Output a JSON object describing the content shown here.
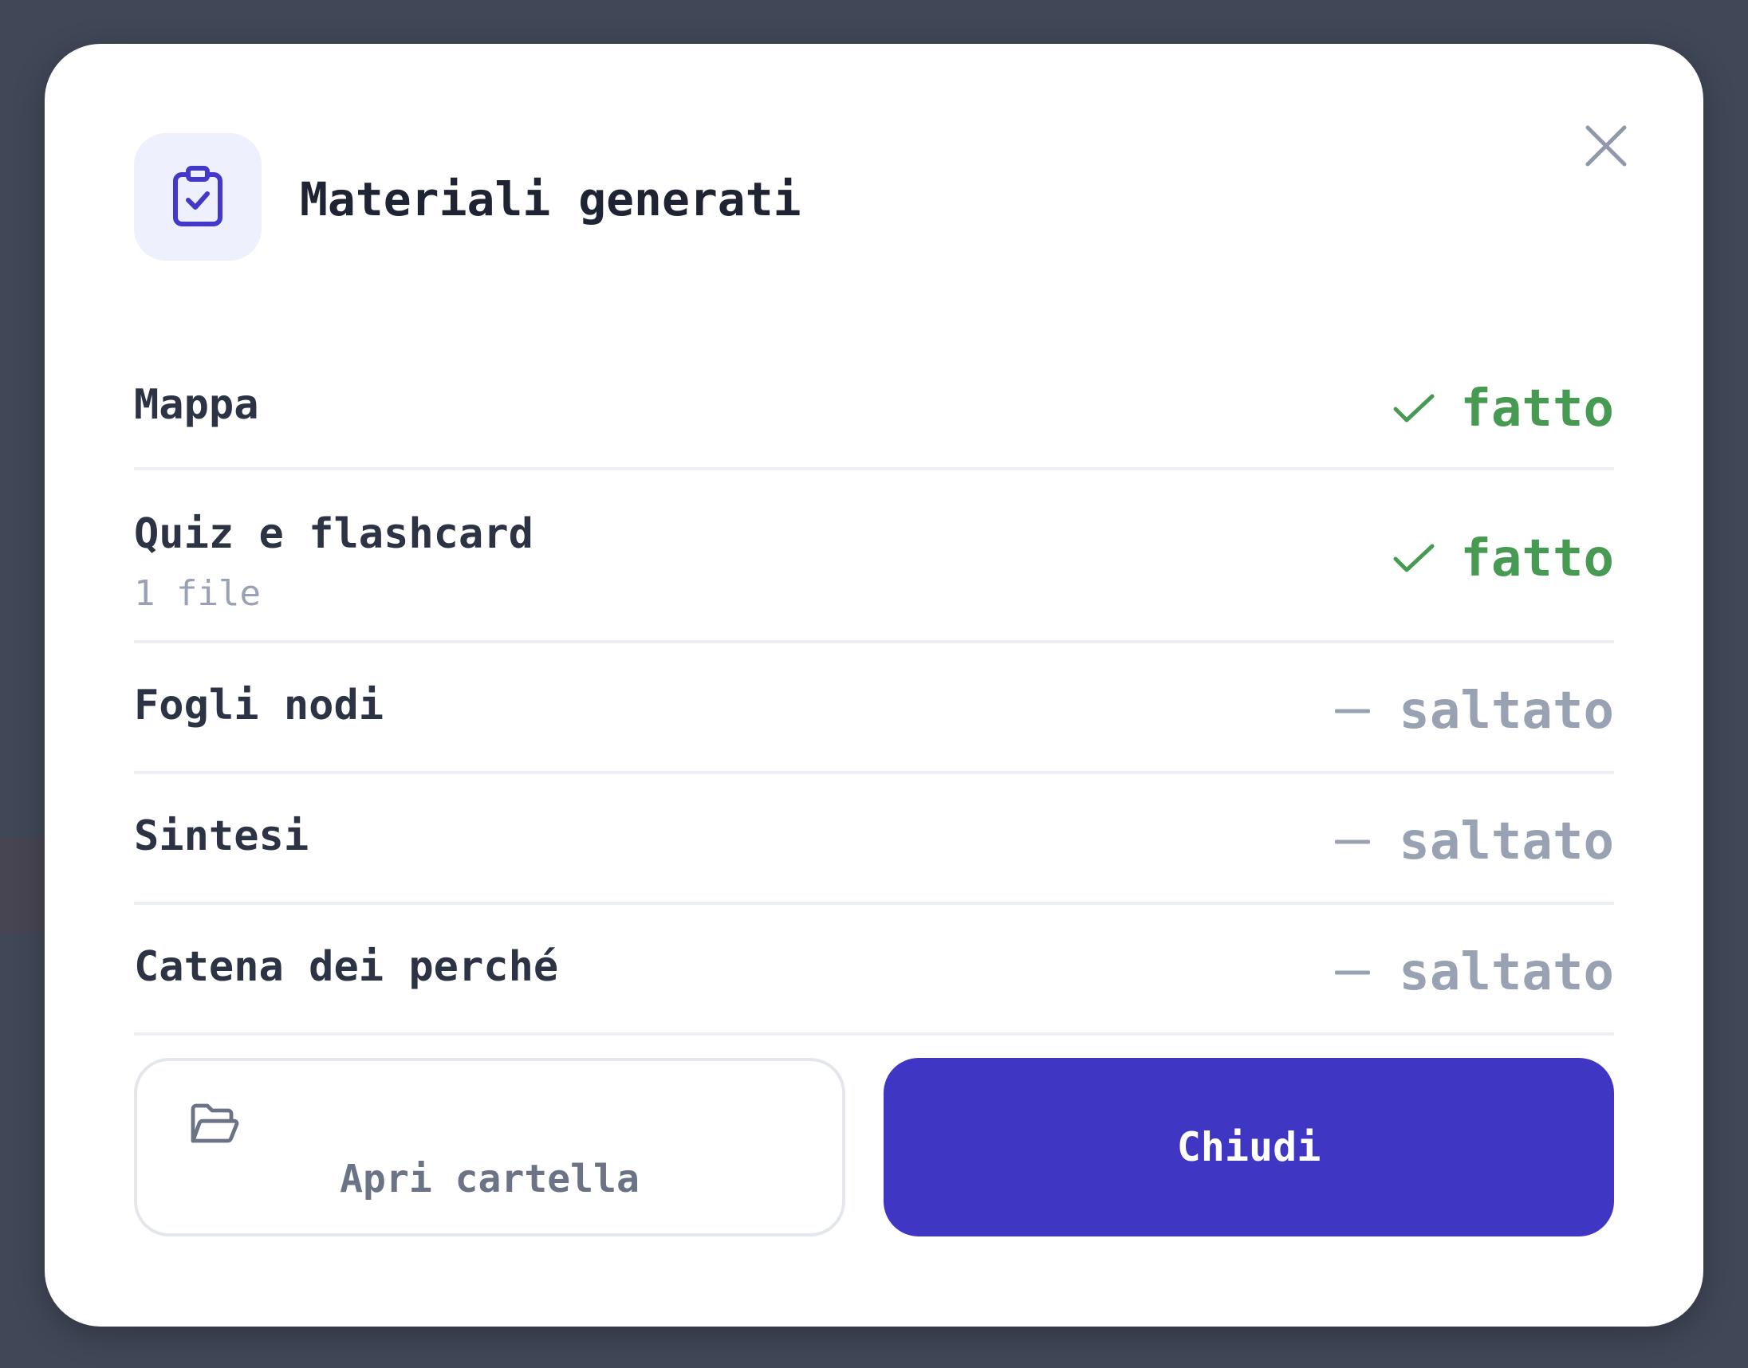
{
  "dialog": {
    "title": "Materiali generati",
    "header_icon": "clipboard-check-icon",
    "close_icon": "close-icon"
  },
  "items": [
    {
      "label": "Mappa",
      "sublabel": "",
      "status": "fatto",
      "status_type": "done",
      "status_icon": "check-icon"
    },
    {
      "label": "Quiz e flashcard",
      "sublabel": "1 file",
      "status": "fatto",
      "status_type": "done",
      "status_icon": "check-icon"
    },
    {
      "label": "Fogli nodi",
      "sublabel": "",
      "status": "saltato",
      "status_type": "skipped",
      "status_icon": "dash-icon"
    },
    {
      "label": "Sintesi",
      "sublabel": "",
      "status": "saltato",
      "status_type": "skipped",
      "status_icon": "dash-icon"
    },
    {
      "label": "Catena dei perché",
      "sublabel": "",
      "status": "saltato",
      "status_type": "skipped",
      "status_icon": "dash-icon"
    }
  ],
  "actions": {
    "open_folder_label": "Apri cartella",
    "open_folder_icon": "folder-open-icon",
    "close_label": "Chiudi"
  },
  "colors": {
    "accent": "#3f37c3",
    "done": "#479a52",
    "skipped": "#98a2b3",
    "overlay": "#404757"
  }
}
